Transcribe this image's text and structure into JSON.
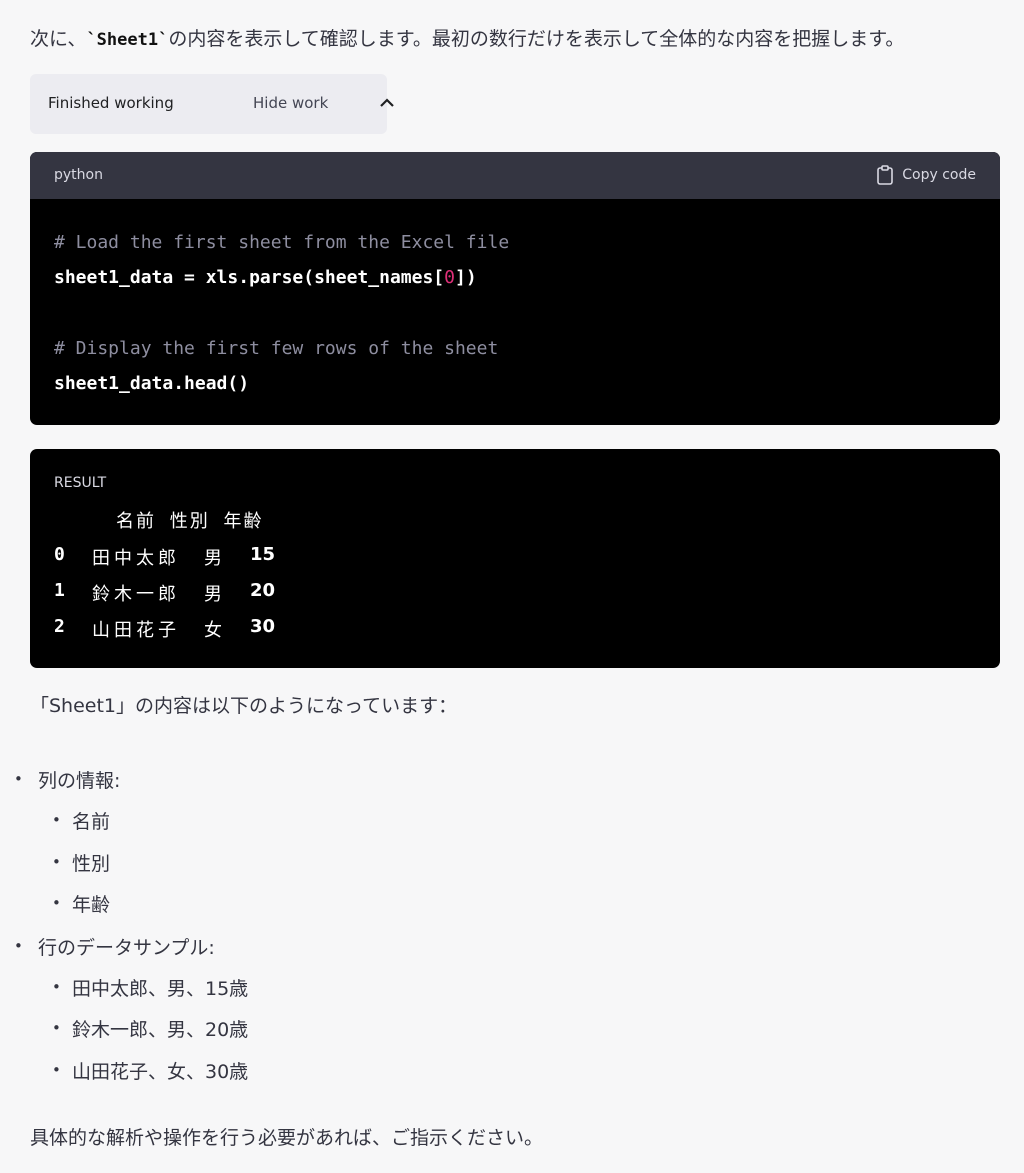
{
  "intro": {
    "prefix": "次に、",
    "code": "`Sheet1`",
    "suffix": "の内容を表示して確認します。最初の数行だけを表示して全体的な内容を把握します。"
  },
  "work_toggle": {
    "status": "Finished working",
    "hide_label": "Hide work",
    "icon": "chevron-up-icon"
  },
  "code_block": {
    "language": "python",
    "copy_label": "Copy code",
    "copy_icon": "clipboard-icon",
    "lines": {
      "l1": "# Load the first sheet from the Excel file",
      "l2a": "sheet1_data = xls.parse(sheet_names[",
      "l2b": "0",
      "l2c": "])",
      "l3": "# Display the first few rows of the sheet",
      "l4": "sheet1_data.head()"
    }
  },
  "result": {
    "label": "RESULT",
    "columns": [
      "名前",
      "性別",
      "年齢"
    ],
    "rows": [
      {
        "idx": "0",
        "name": "田中太郎",
        "gender": "男",
        "age": "15"
      },
      {
        "idx": "1",
        "name": "鈴木一郎",
        "gender": "男",
        "age": "20"
      },
      {
        "idx": "2",
        "name": "山田花子",
        "gender": "女",
        "age": "30"
      }
    ]
  },
  "answer": {
    "intro": "「Sheet1」の内容は以下のようになっています：",
    "columns_heading": "列の情報:",
    "columns": [
      "名前",
      "性別",
      "年齢"
    ],
    "rows_heading": "行のデータサンプル:",
    "rows": [
      "田中太郎、男、15歳",
      "鈴木一郎、男、20歳",
      "山田花子、女、30歳"
    ],
    "closing": "具体的な解析や操作を行う必要があれば、ご指示ください。"
  }
}
